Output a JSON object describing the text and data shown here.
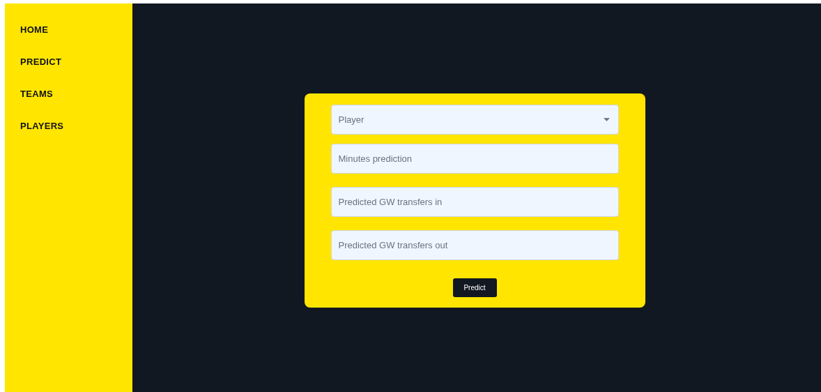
{
  "sidebar": {
    "items": [
      {
        "label": "HOME"
      },
      {
        "label": "PREDICT"
      },
      {
        "label": "TEAMS"
      },
      {
        "label": "PLAYERS"
      }
    ]
  },
  "form": {
    "fields": [
      {
        "kind": "select",
        "placeholder": "Player"
      },
      {
        "kind": "input",
        "placeholder": "Minutes prediction"
      },
      {
        "kind": "input",
        "placeholder": "Predicted GW transfers in"
      },
      {
        "kind": "input",
        "placeholder": "Predicted GW transfers out"
      }
    ],
    "button": "Predict"
  }
}
